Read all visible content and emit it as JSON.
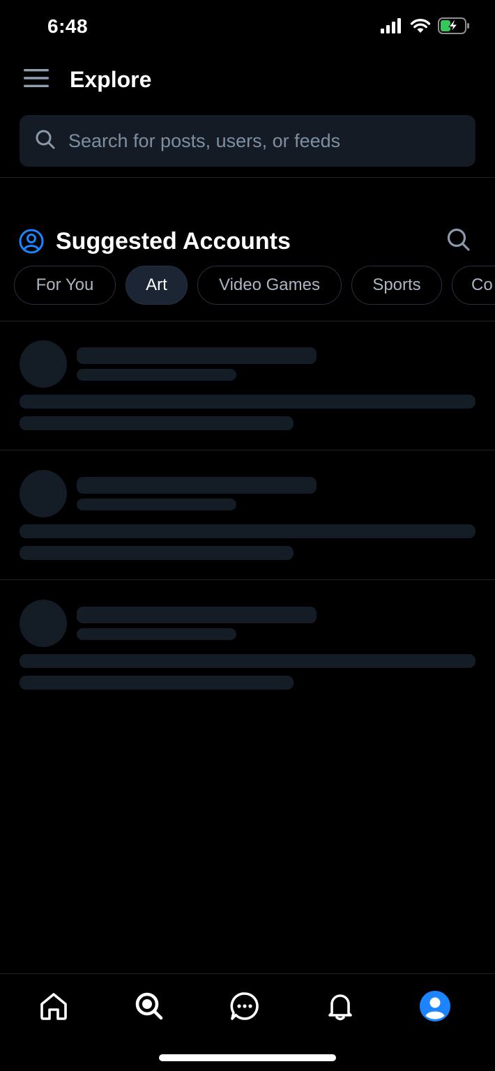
{
  "status_bar": {
    "time": "6:48"
  },
  "header": {
    "title": "Explore"
  },
  "search": {
    "placeholder": "Search for posts, users, or feeds"
  },
  "suggested": {
    "title": "Suggested Accounts",
    "chips": [
      {
        "label": "For You",
        "active": false
      },
      {
        "label": "Art",
        "active": true
      },
      {
        "label": "Video Games",
        "active": false
      },
      {
        "label": "Sports",
        "active": false
      },
      {
        "label": "Co",
        "active": false
      }
    ]
  },
  "colors": {
    "accent": "#1d84ff",
    "battery_green": "#34c759",
    "skeleton": "#141c26",
    "chip_active_bg": "#1b2533"
  },
  "bottom_nav": {
    "items": [
      "home-icon",
      "search-icon",
      "messages-icon",
      "notifications-icon",
      "profile-avatar"
    ],
    "active": "search-icon"
  }
}
